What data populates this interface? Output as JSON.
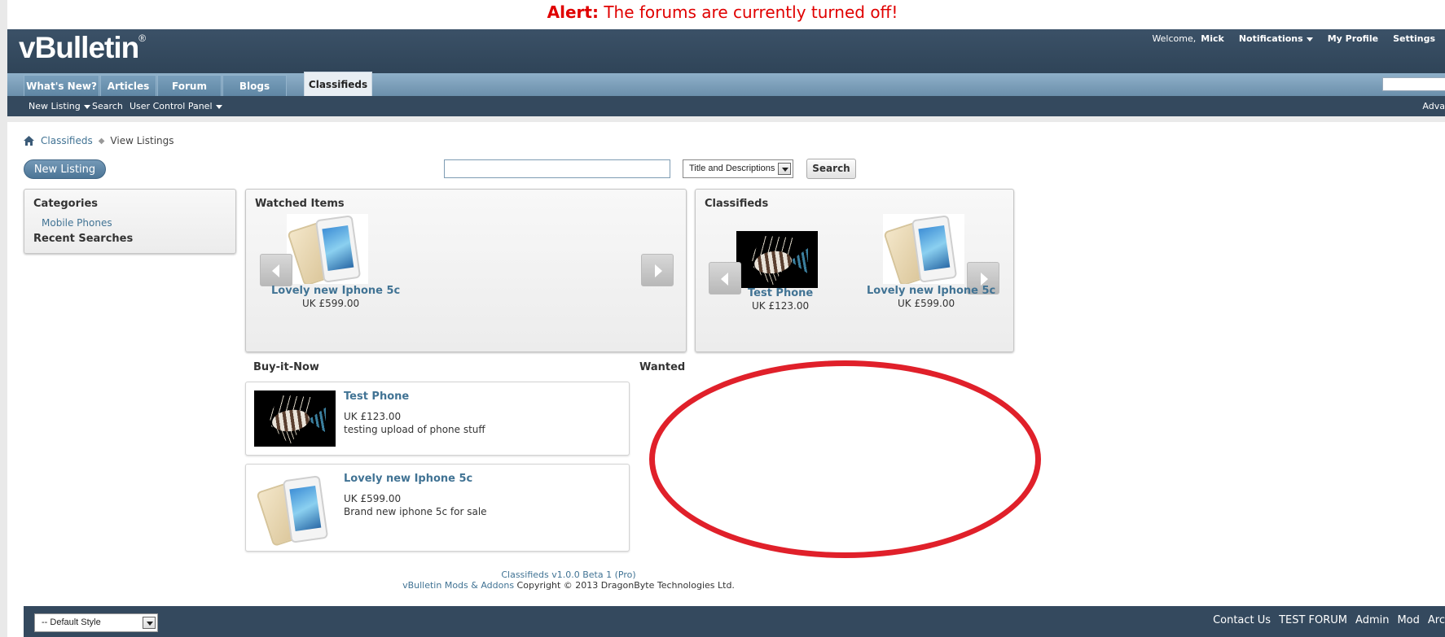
{
  "alert": {
    "label": "Alert:",
    "message": "The forums are currently turned off!"
  },
  "header": {
    "logo": "vBulletin",
    "logo_mark": "®",
    "welcome": "Welcome,",
    "username": "Mick",
    "notifications": "Notifications",
    "my_profile": "My Profile",
    "settings": "Settings"
  },
  "tabs": [
    "What's New?",
    "Articles",
    "Forum",
    "Blogs",
    "Classifieds"
  ],
  "subnav": {
    "new_listing": "New Listing",
    "search": "Search",
    "user_cp": "User Control Panel",
    "advanced": "Adva"
  },
  "breadcrumb": {
    "root": "Classifieds",
    "current": "View Listings"
  },
  "toolbar": {
    "new_listing": "New Listing",
    "search_scope": "Title and Descriptions",
    "search_button": "Search"
  },
  "sidebar": {
    "categories_title": "Categories",
    "category": "Mobile Phones",
    "recent_title": "Recent Searches"
  },
  "watched": {
    "title": "Watched Items",
    "item": {
      "name": "Lovely new Iphone 5c",
      "price": "UK £599.00"
    }
  },
  "classifieds_panel": {
    "title": "Classifieds",
    "items": [
      {
        "name": "Test Phone",
        "price": "UK £123.00"
      },
      {
        "name": "Lovely new Iphone 5c",
        "price": "UK £599.00"
      }
    ]
  },
  "buy_it_now": {
    "title": "Buy-it-Now",
    "listings": [
      {
        "name": "Test Phone",
        "price": "UK £123.00",
        "description": "testing upload of phone stuff"
      },
      {
        "name": "Lovely new Iphone 5c",
        "price": "UK £599.00",
        "description": "Brand new iphone 5c for sale"
      }
    ]
  },
  "wanted": {
    "title": "Wanted"
  },
  "footer": {
    "version": "Classifieds v1.0.0 Beta 1 (Pro)",
    "mods_link": "vBulletin Mods & Addons",
    "copyright": " Copyright © 2013 DragonByte Technologies Ltd.",
    "style": "-- Default Style",
    "links": [
      "Contact Us",
      "TEST FORUM",
      "Admin",
      "Mod",
      "Arc"
    ]
  },
  "colors": {
    "alert": "#e00000",
    "header": "#34495e",
    "link": "#417394",
    "annotation": "#e0202a"
  }
}
